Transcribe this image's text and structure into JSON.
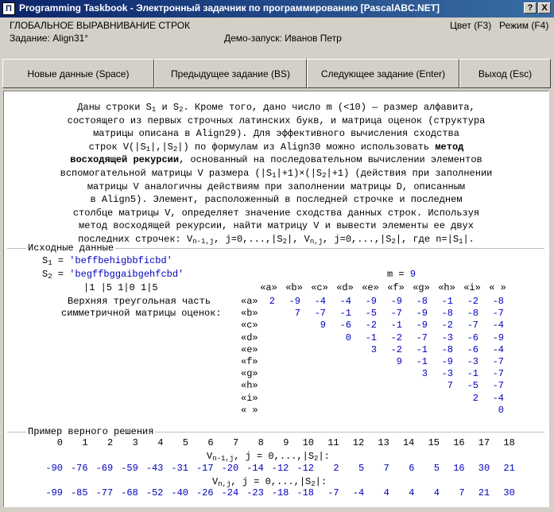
{
  "window": {
    "title": "Programming Taskbook - Электронный задачник по программированию [PascalABC.NET]",
    "icon_label": "П",
    "help_label": "?",
    "close_label": "X"
  },
  "header": {
    "section": "ГЛОБАЛЬНОЕ ВЫРАВНИВАНИЕ СТРОК",
    "task": "Задание: Align31°",
    "demo": "Демо-запуск: Иванов Петр",
    "color": "Цвет (F3)",
    "mode": "Режим (F4)"
  },
  "buttons": {
    "new_data": "Новые данные (Space)",
    "prev_task": "Предыдущее задание (BS)",
    "next_task": "Следующее задание (Enter)",
    "exit": "Выход (Esc)"
  },
  "task_text": {
    "l1a": "Даны строки S",
    "l1s1": "1",
    "l1b": " и S",
    "l1s2": "2",
    "l1c": ". Кроме того, дано число m (<10) — размер алфавита,",
    "l2": "состоящего из первых строчных латинских букв, и матрица оценок (структура",
    "l3": "матрицы описана в Align29). Для эффективного вычисления сходства",
    "l4a": "строк V(|S",
    "l4s1": "1",
    "l4b": "|,|S",
    "l4s2": "2",
    "l4c": "|) по формулам из Align30 можно использовать ",
    "l4bold": "метод",
    "l5bold": "восходящей рекурсии",
    "l5": ", основанный на последовательном вычислении элементов",
    "l6a": "вспомогательной матрицы V размера (|S",
    "l6s1": "1",
    "l6b": "|+1)×(|S",
    "l6s2": "2",
    "l6c": "|+1) (действия при заполнении",
    "l7": "матрицы V аналогичны действиям при заполнении матрицы D, описанным",
    "l8": "в Align5). Элемент, расположенный в последней строчке и последнем",
    "l9": "столбце матрицы V, определяет значение сходства данных строк. Используя",
    "l10": "метод восходящей рекурсии, найти матрицу V и вывести элементы ее двух",
    "l11a": "последних строчек: V",
    "l11s1": "n-1,j",
    "l11b": ", j=0,...,|S",
    "l11s2": "2",
    "l11c": "|, V",
    "l11s3": "n,j",
    "l11d": ", j=0,...,|S",
    "l11s4": "2",
    "l11e": "|, где n=|S",
    "l11s5": "1",
    "l11f": "|."
  },
  "input": {
    "title": "Исходные данные",
    "s1_label": "S",
    "s1_sub": "1",
    "s1_eq": " = ",
    "s1_value": "'beffbehigbbficbd'",
    "s2_label": "S",
    "s2_sub": "2",
    "s2_eq": " = ",
    "s2_value": "'begffbggaibgehfcbd'",
    "m_label": "m = ",
    "m_value": "9",
    "ruler": "|1  |5  1|0  1|5",
    "matrix_caption1": "Верхняя треугольная часть",
    "matrix_caption2": "симметричной матрицы оценок:",
    "col_headers": [
      "«a»",
      "«b»",
      "«c»",
      "«d»",
      "«e»",
      "«f»",
      "«g»",
      "«h»",
      "«i»",
      "« »"
    ],
    "row_headers": [
      "«a»",
      "«b»",
      "«c»",
      "«d»",
      "«e»",
      "«f»",
      "«g»",
      "«h»",
      "«i»",
      "« »"
    ],
    "matrix": [
      [
        "2",
        "-9",
        "-4",
        "-4",
        "-9",
        "-9",
        "-8",
        "-1",
        "-2",
        "-8"
      ],
      [
        "7",
        "-7",
        "-1",
        "-5",
        "-7",
        "-9",
        "-8",
        "-8",
        "-7"
      ],
      [
        "9",
        "-6",
        "-2",
        "-1",
        "-9",
        "-2",
        "-7",
        "-4"
      ],
      [
        "0",
        "-1",
        "-2",
        "-7",
        "-3",
        "-6",
        "-9"
      ],
      [
        "3",
        "-2",
        "-1",
        "-8",
        "-6",
        "-4"
      ],
      [
        "9",
        "-1",
        "-9",
        "-3",
        "-7"
      ],
      [
        "3",
        "-3",
        "-1",
        "-7"
      ],
      [
        "7",
        "-5",
        "-7"
      ],
      [
        "2",
        "-4"
      ],
      [
        "0"
      ]
    ]
  },
  "solution": {
    "title": "Пример верного решения",
    "col_index": [
      "0",
      "1",
      "2",
      "3",
      "4",
      "5",
      "6",
      "7",
      "8",
      "9",
      "10",
      "11",
      "12",
      "13",
      "14",
      "15",
      "16",
      "17",
      "18"
    ],
    "vn1_a": "V",
    "vn1_sub": "n-1,j",
    "vn1_b": ", j = 0,...,|S",
    "vn1_sub2": "2",
    "vn1_c": "|:",
    "row_n1": [
      "-90",
      "-76",
      "-69",
      "-59",
      "-43",
      "-31",
      "-17",
      "-20",
      "-14",
      "-12",
      "-12",
      "2",
      "5",
      "7",
      "6",
      "5",
      "16",
      "30",
      "21"
    ],
    "vn_a": "V",
    "vn_sub": "n,j",
    "vn_b": ", j = 0,...,|S",
    "vn_sub2": "2",
    "vn_c": "|:",
    "row_n": [
      "-99",
      "-85",
      "-77",
      "-68",
      "-52",
      "-40",
      "-26",
      "-24",
      "-23",
      "-18",
      "-18",
      "-7",
      "-4",
      "4",
      "4",
      "4",
      "7",
      "21",
      "30"
    ]
  }
}
